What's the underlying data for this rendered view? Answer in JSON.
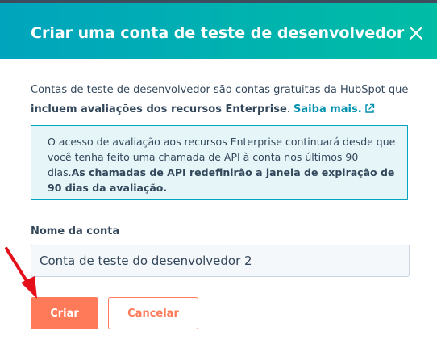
{
  "dialog": {
    "title": "Criar uma conta de teste de desenvolvedor",
    "close_icon": "close-icon"
  },
  "intro": {
    "text_prefix": "Contas de teste de desenvolvedor são contas gratuitas da HubSpot que ",
    "bold_text": "incluem avaliações dos recursos Enterprise",
    "separator": ". ",
    "link_label": "Saiba mais.",
    "link_icon": "external-link-icon"
  },
  "alert": {
    "text": "O acesso de avaliação aos recursos Enterprise continuará desde que você tenha feito uma chamada de API à conta nos últimos 90 dias.",
    "bold_text": "As chamadas de API redefinirão a janela de expiração de 90 dias da avaliação."
  },
  "form": {
    "account_name_label": "Nome da conta",
    "account_name_value": "Conta de teste do desenvolvedor 2"
  },
  "buttons": {
    "create_label": "Criar",
    "cancel_label": "Cancelar"
  },
  "annotation": {
    "arrow_icon": "red-arrow-icon"
  },
  "colors": {
    "header_gradient_start": "#00a4bd",
    "header_gradient_end": "#00bda5",
    "primary": "#ff7a59",
    "link": "#0091ae",
    "text": "#33475b",
    "alert_bg": "#e5f5f8",
    "annotation_arrow": "#e3101a"
  }
}
